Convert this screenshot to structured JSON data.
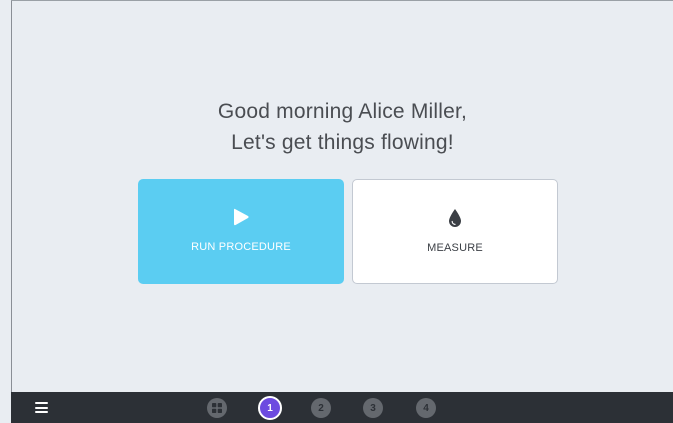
{
  "greeting": {
    "line1": "Good morning Alice Miller,",
    "line2": "Let's get things flowing!"
  },
  "actions": {
    "run_procedure": {
      "label": "RUN PROCEDURE",
      "icon": "play-icon"
    },
    "measure": {
      "label": "MEASURE",
      "icon": "drop-icon"
    }
  },
  "bottom_bar": {
    "menu_icon": "hamburger-menu-icon",
    "home_icon": "grid-icon",
    "steps": [
      "1",
      "2",
      "3",
      "4"
    ],
    "active_step": "1"
  },
  "colors": {
    "background": "#e9edf2",
    "run_card": "#5bcdf2",
    "active_step": "#6d4be0",
    "bottom_bar": "#2c3036"
  }
}
